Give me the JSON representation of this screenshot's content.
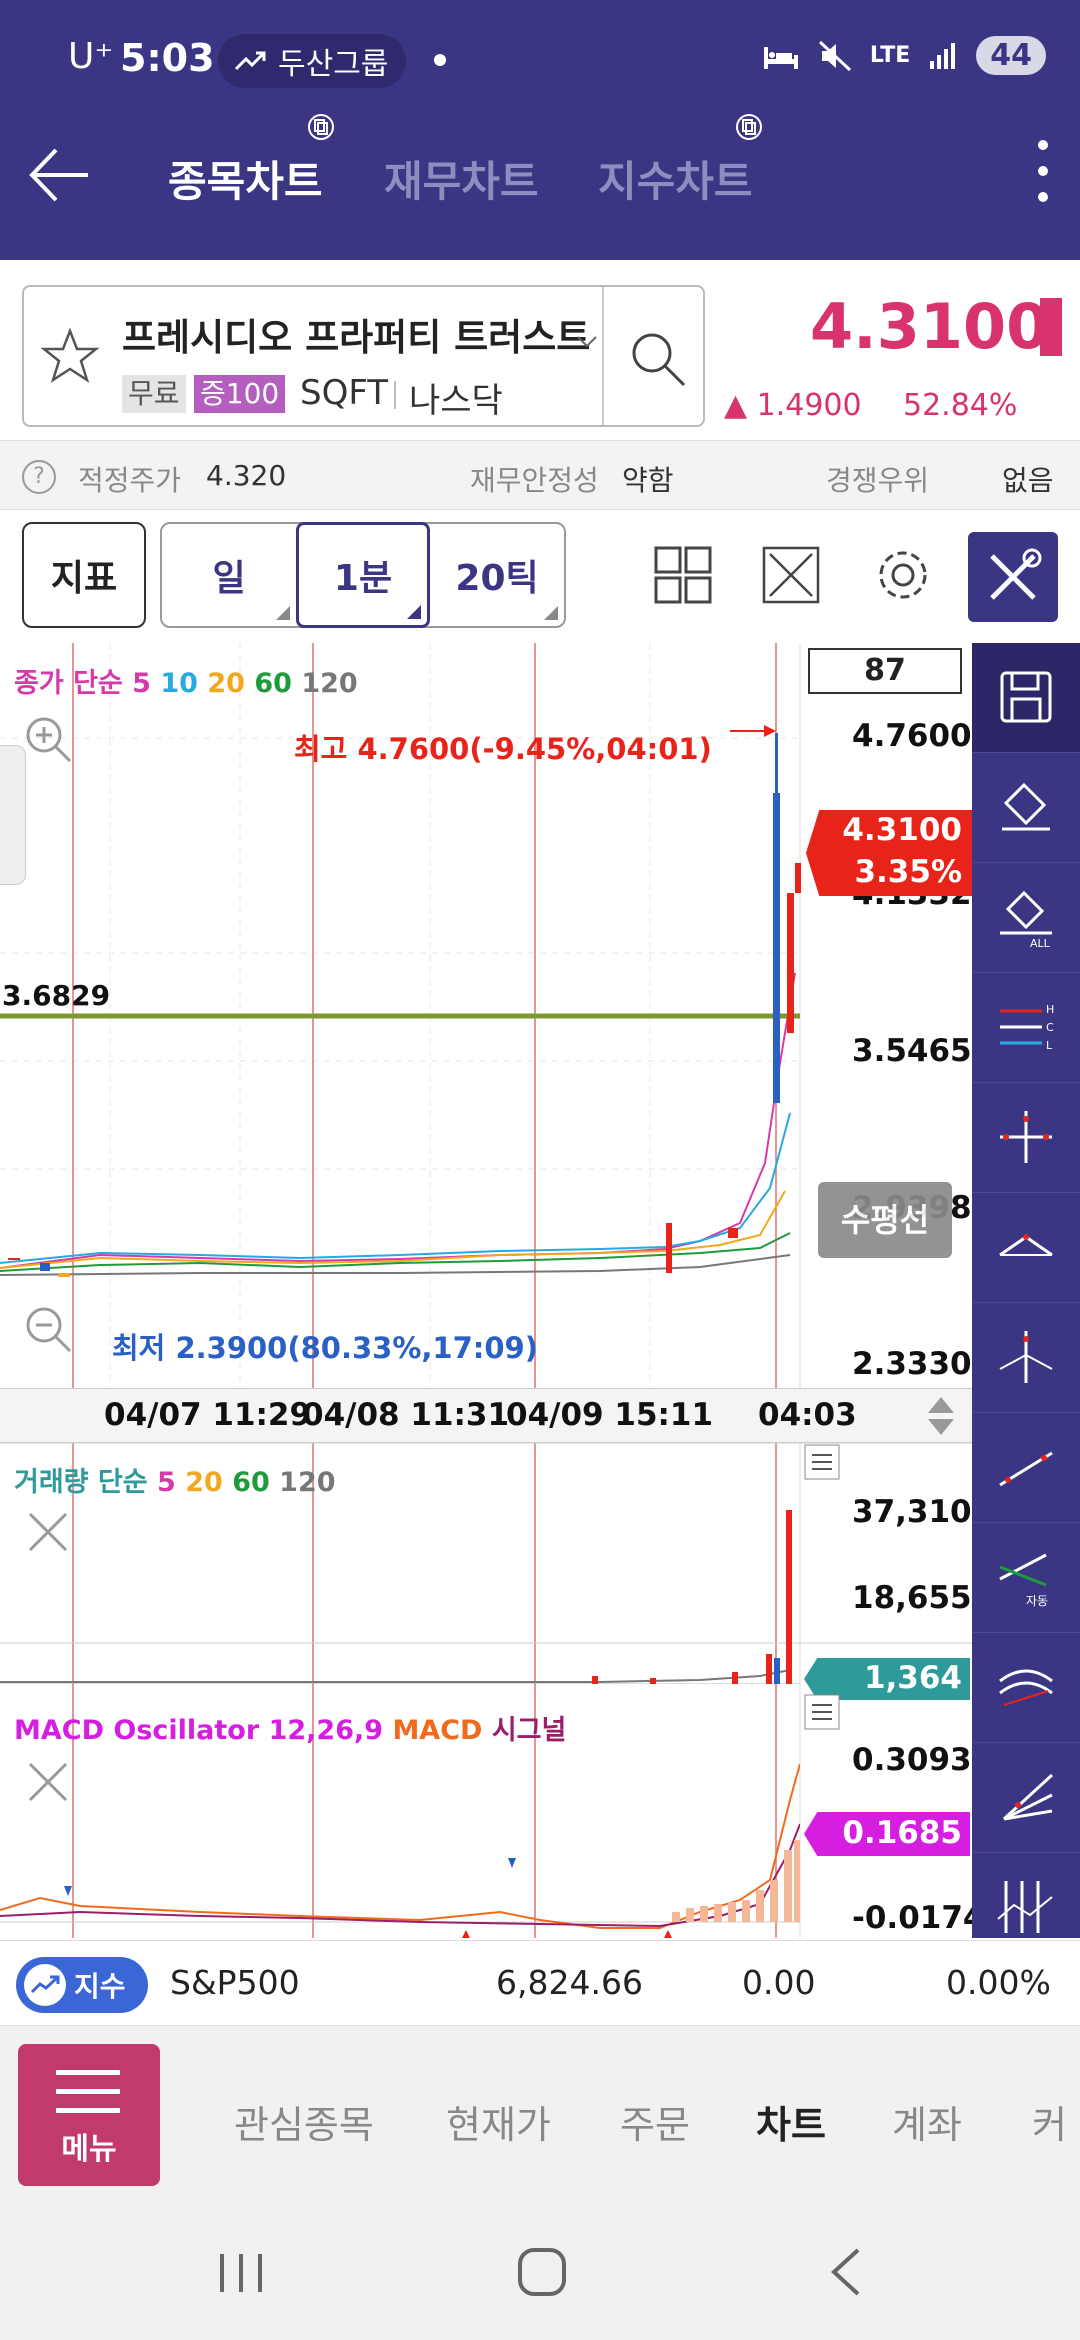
{
  "status_bar": {
    "carrier": "U⁺",
    "time": "5:03",
    "group_chip": "두산그룹",
    "network": "LTE",
    "battery": "44"
  },
  "header": {
    "tabs": [
      {
        "label": "종목차트",
        "active": true
      },
      {
        "label": "재무차트",
        "active": false
      },
      {
        "label": "지수차트",
        "active": false
      }
    ]
  },
  "stock": {
    "name": "프레시디오 프라퍼티 트러스트",
    "tag_free": "무료",
    "tag_index": "증100",
    "ticker": "SQFT",
    "market": "나스닥",
    "price": "4.3100",
    "change": "▲ 1.4900",
    "change_pct": "52.84%"
  },
  "fair_row": {
    "fair_label": "적정주가",
    "fair_value": "4.320",
    "stability_label": "재무안정성",
    "stability_value": "약함",
    "competition_label": "경쟁우위",
    "competition_value": "없음"
  },
  "toolbar": {
    "indicator_label": "지표",
    "periods": [
      {
        "label": "일",
        "selected": false
      },
      {
        "label": "1분",
        "selected": true
      },
      {
        "label": "20틱",
        "selected": false
      }
    ]
  },
  "price_pane": {
    "count_box": "87",
    "legend_prefix": "종가 단순",
    "legend_ma": [
      {
        "label": "5",
        "color": "#d63aa8"
      },
      {
        "label": "10",
        "color": "#27a9e1"
      },
      {
        "label": "20",
        "color": "#f2a81d"
      },
      {
        "label": "60",
        "color": "#1e9b3a"
      },
      {
        "label": "120",
        "color": "#777777"
      }
    ],
    "high_annotation": "최고 4.7600(-9.45%,04:01)",
    "low_annotation": "최저 2.3900(80.33%,17:09)",
    "left_level": "3.6829",
    "axis": [
      "4.7600",
      "4.1332",
      "3.5465",
      "2.9398",
      "2.3330"
    ],
    "current_tag_price": "4.3100",
    "current_tag_pct": "3.35%",
    "horizon_label": "수평선"
  },
  "time_axis": [
    "04/07 11:29",
    "04/08 11:31",
    "04/09 15:11",
    "04:03"
  ],
  "volume_pane": {
    "legend_prefix": "거래량 단순",
    "legend_ma": [
      {
        "label": "5",
        "color": "#d63aa8"
      },
      {
        "label": "20",
        "color": "#f2a81d"
      },
      {
        "label": "60",
        "color": "#1e9b3a"
      },
      {
        "label": "120",
        "color": "#777777"
      }
    ],
    "axis": [
      "37,310",
      "18,655"
    ],
    "current_tag": "1,364"
  },
  "macd_pane": {
    "legend_main": "MACD Oscillator 12,26,9",
    "legend_macd": "MACD",
    "legend_signal": "시그널",
    "axis": [
      "0.3093",
      "-0.0174"
    ],
    "current_tag": "0.1685"
  },
  "index_bar": {
    "pill_label": "지수",
    "name": "S&P500",
    "value": "6,824.66",
    "change": "0.00",
    "change_pct": "0.00%"
  },
  "bottom_nav": {
    "menu_label": "메뉴",
    "items": [
      {
        "label": "관심종목",
        "active": false
      },
      {
        "label": "현재가",
        "active": false
      },
      {
        "label": "주문",
        "active": false
      },
      {
        "label": "차트",
        "active": true
      },
      {
        "label": "계좌",
        "active": false
      },
      {
        "label": "커",
        "active": false
      }
    ]
  },
  "colors": {
    "header_bg": "#3b3684",
    "price_red": "#d9336f",
    "tag_red": "#e8231a",
    "volume_tag": "#2e9a9a",
    "macd_tag": "#d61ee0",
    "level_line": "#7a9a2e"
  }
}
